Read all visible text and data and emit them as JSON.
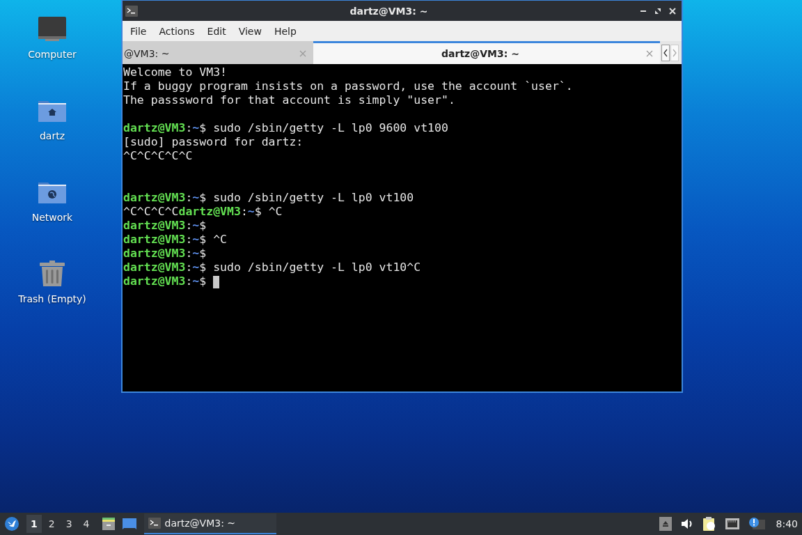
{
  "desktop_icons": [
    {
      "kind": "computer",
      "label": "Computer"
    },
    {
      "kind": "home",
      "label": "dartz"
    },
    {
      "kind": "network",
      "label": "Network"
    },
    {
      "kind": "trash",
      "label": "Trash (Empty)"
    }
  ],
  "window": {
    "title": "dartz@VM3: ~",
    "menu": [
      "File",
      "Actions",
      "Edit",
      "View",
      "Help"
    ],
    "tabs": [
      {
        "label": "@VM3: ~",
        "selected": false
      },
      {
        "label": "dartz@VM3: ~",
        "selected": true
      }
    ],
    "terminal_lines": [
      [
        {
          "kind": "plain",
          "text": "Welcome to VM3!"
        }
      ],
      [
        {
          "kind": "plain",
          "text": "If a buggy program insists on a password, use the account `user`."
        }
      ],
      [
        {
          "kind": "plain",
          "text": "The passsword for that account is simply \"user\"."
        }
      ],
      [
        {
          "kind": "blank"
        }
      ],
      [
        {
          "kind": "user",
          "text": "dartz@VM3"
        },
        {
          "kind": "plain",
          "text": ":"
        },
        {
          "kind": "path",
          "text": "~"
        },
        {
          "kind": "plain",
          "text": "$ sudo /sbin/getty -L lp0 9600 vt100"
        }
      ],
      [
        {
          "kind": "plain",
          "text": "[sudo] password for dartz:"
        }
      ],
      [
        {
          "kind": "plain",
          "text": "^C^C^C^C^C"
        }
      ],
      [
        {
          "kind": "blank"
        }
      ],
      [
        {
          "kind": "blank"
        }
      ],
      [
        {
          "kind": "user",
          "text": "dartz@VM3"
        },
        {
          "kind": "plain",
          "text": ":"
        },
        {
          "kind": "path",
          "text": "~"
        },
        {
          "kind": "plain",
          "text": "$ sudo /sbin/getty -L lp0 vt100"
        }
      ],
      [
        {
          "kind": "plain",
          "text": "^C^C^C^C"
        },
        {
          "kind": "user",
          "text": "dartz@VM3"
        },
        {
          "kind": "plain",
          "text": ":"
        },
        {
          "kind": "path",
          "text": "~"
        },
        {
          "kind": "plain",
          "text": "$ ^C"
        }
      ],
      [
        {
          "kind": "user",
          "text": "dartz@VM3"
        },
        {
          "kind": "plain",
          "text": ":"
        },
        {
          "kind": "path",
          "text": "~"
        },
        {
          "kind": "plain",
          "text": "$"
        }
      ],
      [
        {
          "kind": "user",
          "text": "dartz@VM3"
        },
        {
          "kind": "plain",
          "text": ":"
        },
        {
          "kind": "path",
          "text": "~"
        },
        {
          "kind": "plain",
          "text": "$ ^C"
        }
      ],
      [
        {
          "kind": "user",
          "text": "dartz@VM3"
        },
        {
          "kind": "plain",
          "text": ":"
        },
        {
          "kind": "path",
          "text": "~"
        },
        {
          "kind": "plain",
          "text": "$"
        }
      ],
      [
        {
          "kind": "user",
          "text": "dartz@VM3"
        },
        {
          "kind": "plain",
          "text": ":"
        },
        {
          "kind": "path",
          "text": "~"
        },
        {
          "kind": "plain",
          "text": "$ sudo /sbin/getty -L lp0 vt10^C"
        }
      ],
      [
        {
          "kind": "user",
          "text": "dartz@VM3"
        },
        {
          "kind": "plain",
          "text": ":"
        },
        {
          "kind": "path",
          "text": "~"
        },
        {
          "kind": "plain",
          "text": "$ "
        },
        {
          "kind": "cursor"
        }
      ]
    ]
  },
  "taskbar": {
    "workspaces": [
      {
        "label": "1",
        "selected": true
      },
      {
        "label": "2",
        "selected": false
      },
      {
        "label": "3",
        "selected": false
      },
      {
        "label": "4",
        "selected": false
      }
    ],
    "tasks": [
      {
        "label": "dartz@VM3: ~",
        "selected": true
      }
    ],
    "clock": "8:40"
  }
}
